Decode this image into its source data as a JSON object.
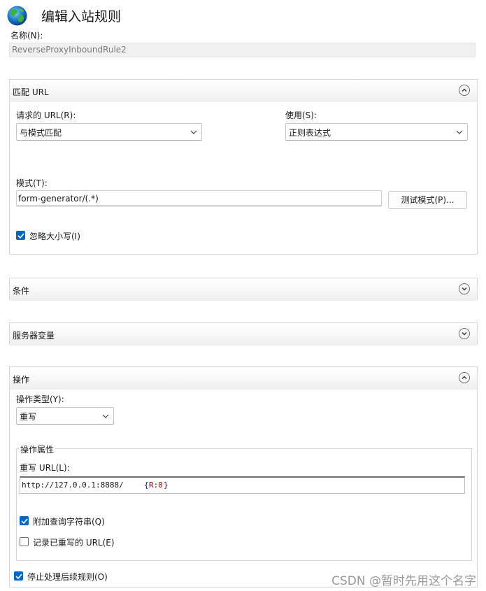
{
  "dialog": {
    "title": "编辑入站规则",
    "name_label": "名称(N):",
    "name_value": "ReverseProxyInboundRule2"
  },
  "match_url": {
    "header": "匹配 URL",
    "requested_url_label": "请求的 URL(R):",
    "requested_url_value": "与模式匹配",
    "using_label": "使用(S):",
    "using_value": "正则表达式",
    "pattern_label": "模式(T):",
    "pattern_value": "form-generator/(.*)",
    "test_button": "测试模式(P)...",
    "ignore_case_label": "忽略大小写(I)",
    "ignore_case_checked": true
  },
  "conditions": {
    "header": "条件"
  },
  "server_variables": {
    "header": "服务器变量"
  },
  "action": {
    "header": "操作",
    "type_label": "操作类型(Y):",
    "type_value": "重写",
    "properties_legend": "操作属性",
    "rewrite_url_label": "重写 URL(L):",
    "rewrite_url_prefix": "http://127.0.0.1:8888/",
    "rewrite_url_brace_open": "{",
    "rewrite_url_var": "R:0",
    "rewrite_url_brace_close": "}",
    "append_query_label": "附加查询字符串(Q)",
    "append_query_checked": true,
    "log_rewritten_label": "记录已重写的 URL(E)",
    "log_rewritten_checked": false,
    "stop_processing_label": "停止处理后续规则(O)",
    "stop_processing_checked": true
  },
  "watermark": "CSDN @暂时先用这个名字",
  "colors": {
    "accent": "#0067c0",
    "brace": "#0000ff",
    "var": "#800000"
  }
}
